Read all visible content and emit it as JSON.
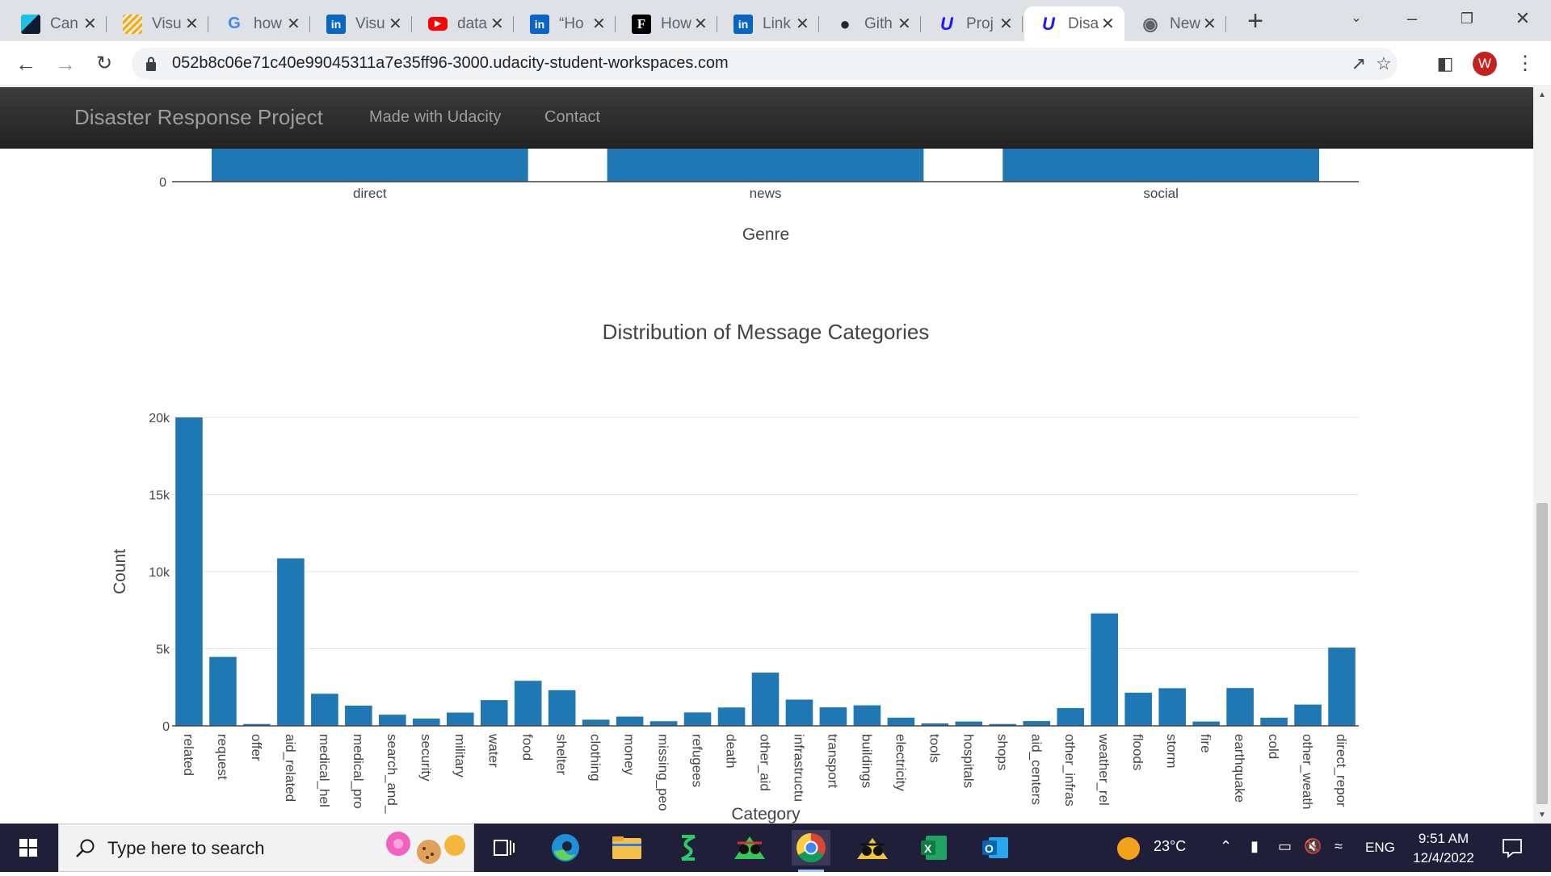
{
  "browser": {
    "tabs": [
      {
        "label": "Can",
        "icon": "canva-icon",
        "color": "#0f1a2e"
      },
      {
        "label": "Visu",
        "icon": "striped-icon",
        "color": "#f5a623"
      },
      {
        "label": "how",
        "icon": "google-icon",
        "color": "#4285f4"
      },
      {
        "label": "Visu",
        "icon": "linkedin-icon",
        "color": "#0a66c2"
      },
      {
        "label": "data",
        "icon": "youtube-icon",
        "color": "#ff0000"
      },
      {
        "label": "“Ho",
        "icon": "linkedin-icon",
        "color": "#0a66c2"
      },
      {
        "label": "How",
        "icon": "f-icon",
        "color": "#000000"
      },
      {
        "label": "Link",
        "icon": "linkedin-icon",
        "color": "#0a66c2"
      },
      {
        "label": "Gith",
        "icon": "github-icon",
        "color": "#24292e"
      },
      {
        "label": "Proj",
        "icon": "udacity-icon",
        "color": "#2015ff"
      },
      {
        "label": "Disa",
        "icon": "udacity-icon",
        "color": "#2015ff",
        "active": true
      },
      {
        "label": "New",
        "icon": "chromium-icon",
        "color": "#5f6368"
      }
    ],
    "url": "052b8c06e71c40e99045311a7e35ff96-3000.udacity-student-workspaces.com",
    "profile_initial": "W"
  },
  "navbar": {
    "brand": "Disaster Response Project",
    "links": [
      "Made with Udacity",
      "Contact"
    ]
  },
  "genre_chart": {
    "type": "bar",
    "categories": [
      "direct",
      "news",
      "social"
    ],
    "xlabel": "Genre",
    "visible_tick": "0"
  },
  "chart_data": {
    "type": "bar",
    "title": "Distribution of Message Categories",
    "xlabel": "Category",
    "ylabel": "Count",
    "ylim": [
      0,
      20000
    ],
    "yticks": [
      "0",
      "5k",
      "10k",
      "15k",
      "20k"
    ],
    "color": "#1f77b4",
    "categories": [
      "related",
      "request",
      "offer",
      "aid_related",
      "medical_hel",
      "medical_pro",
      "search_and_",
      "security",
      "military",
      "water",
      "food",
      "shelter",
      "clothing",
      "money",
      "missing_peo",
      "refugees",
      "death",
      "other_aid",
      "infrastructu",
      "transport",
      "buildings",
      "electricity",
      "tools",
      "hospitals",
      "shops",
      "aid_centers",
      "other_infras",
      "weather_rel",
      "floods",
      "storm",
      "fire",
      "earthquake",
      "cold",
      "other_weath",
      "direct_repor"
    ],
    "values": [
      20000,
      4470,
      120,
      10860,
      2080,
      1310,
      720,
      470,
      860,
      1670,
      2920,
      2310,
      400,
      600,
      300,
      870,
      1190,
      3450,
      1700,
      1200,
      1330,
      530,
      160,
      280,
      120,
      310,
      1150,
      7290,
      2150,
      2440,
      280,
      2450,
      530,
      1380,
      5070
    ]
  },
  "taskbar": {
    "search_placeholder": "Type here to search",
    "temperature": "23°C",
    "language": "ENG",
    "time": "9:51 AM",
    "date": "12/4/2022"
  }
}
